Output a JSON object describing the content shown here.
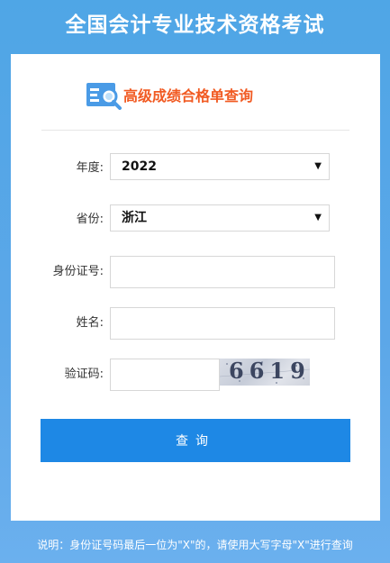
{
  "header": {
    "title": "全国会计专业技术资格考试"
  },
  "card": {
    "heading": "高级成绩合格单查询",
    "logo_icon": "search-document-icon"
  },
  "form": {
    "year": {
      "label": "年度:",
      "value": "2022"
    },
    "province": {
      "label": "省份:",
      "value": "浙江"
    },
    "id_number": {
      "label": "身份证号:",
      "value": ""
    },
    "name": {
      "label": "姓名:",
      "value": ""
    },
    "captcha": {
      "label": "验证码:",
      "value": "",
      "code": "6619"
    },
    "submit_label": "查询"
  },
  "footer": {
    "note": "说明：身份证号码最后一位为\"X\"的，请使用大写字母\"X\"进行查询"
  },
  "colors": {
    "background": "#4fa6e6",
    "heading": "#f15a22",
    "button": "#1e88e5",
    "icon": "#4a9be6"
  }
}
